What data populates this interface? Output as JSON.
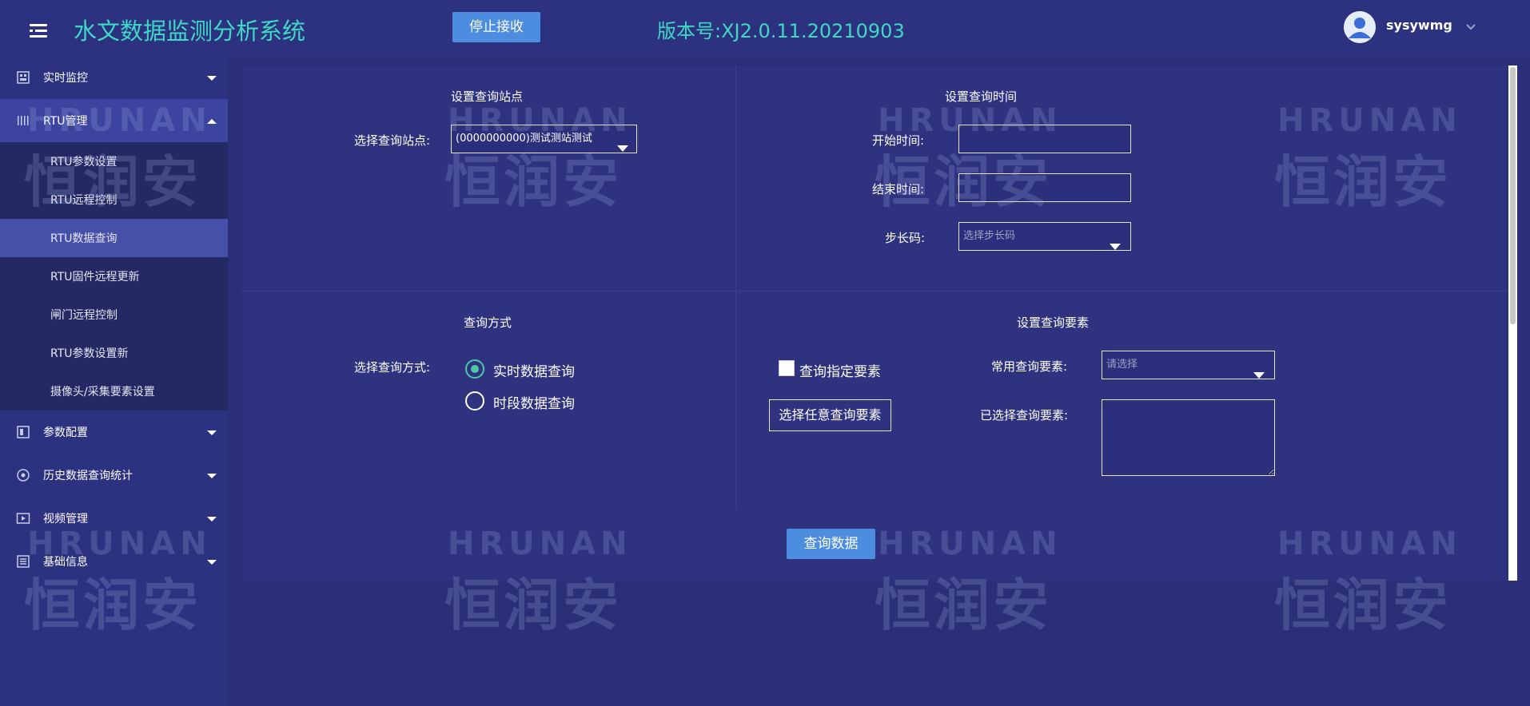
{
  "header": {
    "app_title": "水文数据监测分析系统",
    "stop_button": "停止接收",
    "version": "版本号:XJ2.0.11.20210903",
    "username": "sysywmg"
  },
  "sidebar": {
    "groups": [
      {
        "label": "实时监控",
        "icon": "monitor-icon"
      },
      {
        "label": "RTU管理",
        "icon": "rtu-bars-icon"
      },
      {
        "label": "参数配置",
        "icon": "document-icon"
      },
      {
        "label": "历史数据查询统计",
        "icon": "target-icon"
      },
      {
        "label": "视频管理",
        "icon": "video-play-icon"
      },
      {
        "label": "基础信息",
        "icon": "book-icon"
      }
    ],
    "rtu_items": [
      "RTU参数设置",
      "RTU远程控制",
      "RTU数据查询",
      "RTU固件远程更新",
      "闸门远程控制",
      "RTU参数设置新",
      "摄像头/采集要素设置"
    ],
    "active_item": "RTU数据查询"
  },
  "watermark": {
    "brand_en": "HRUNAN",
    "brand_cn": "恒润安"
  },
  "station_section": {
    "title": "设置查询站点",
    "label": "选择查询站点:",
    "value": "(0000000000)测试测站测试"
  },
  "time_section": {
    "title": "设置查询时间",
    "start_label": "开始时间:",
    "start_value": "",
    "end_label": "结束时间:",
    "end_value": "",
    "step_label": "步长码:",
    "step_placeholder": "选择步长码"
  },
  "mode_section": {
    "title": "查询方式",
    "label": "选择查询方式:",
    "options": [
      {
        "label": "实时数据查询",
        "checked": true
      },
      {
        "label": "时段数据查询",
        "checked": false
      }
    ]
  },
  "element_section": {
    "title": "设置查询要素",
    "checkbox_label": "查询指定要素",
    "choose_button": "选择任意查询要素",
    "common_label": "常用查询要素:",
    "common_placeholder": "请选择",
    "selected_label": "已选择查询要素:",
    "selected_value": ""
  },
  "query_button": "查询数据",
  "colors": {
    "background": "#2b2f78",
    "header": "#2d3280",
    "accent_teal": "#3ed8c3",
    "button_blue": "#4c8de0",
    "radio_green": "#4ec7a6"
  }
}
